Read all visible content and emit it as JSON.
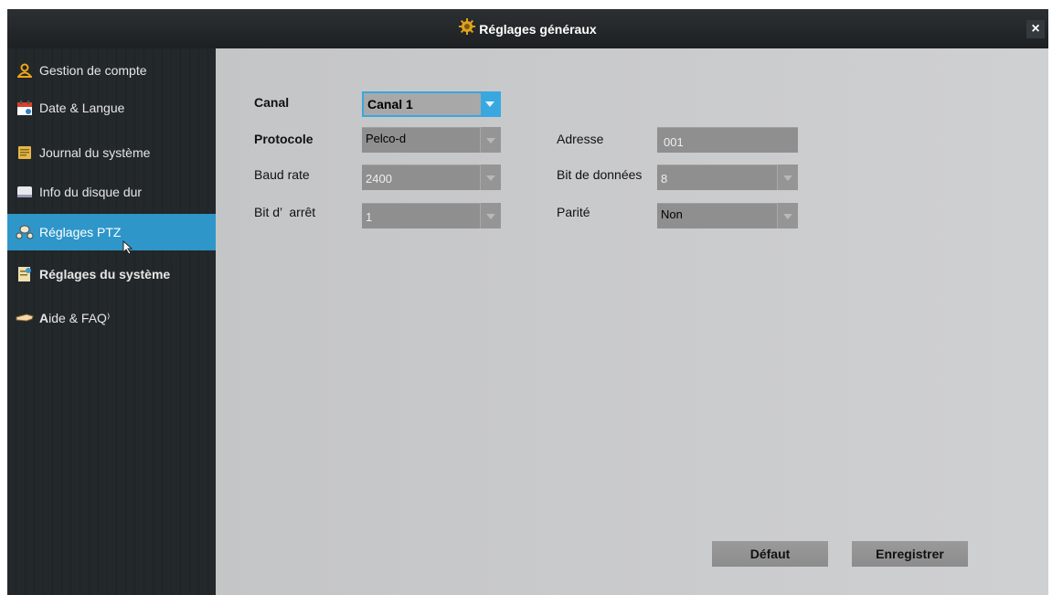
{
  "window": {
    "title": "Réglages généraux",
    "close_label": "×"
  },
  "sidebar": {
    "items": [
      {
        "label": "Gestion de compte",
        "icon": "user-icon"
      },
      {
        "label": "Date & Langue",
        "icon": "calendar-icon"
      },
      {
        "label": "Journal du système",
        "icon": "log-book-icon"
      },
      {
        "label": "Info du disque dur",
        "icon": "hard-disk-icon"
      },
      {
        "label": "Réglages PTZ",
        "icon": "ptz-camera-icon",
        "active": true
      },
      {
        "label": "Réglages du système",
        "icon": "system-settings-icon"
      },
      {
        "label_bold": "A",
        "label": " ide & FAQ⁾",
        "icon": "help-hand-icon"
      }
    ]
  },
  "form": {
    "canal": {
      "label": "Canal",
      "value": "Canal 1"
    },
    "protocole": {
      "label": "Protocole",
      "value": "Pelco-d"
    },
    "adresse": {
      "label": "Adresse",
      "value": "001"
    },
    "baud_rate": {
      "label": "Baud rate",
      "value": "2400"
    },
    "bit_donnees": {
      "label": "Bit de données",
      "value": "8"
    },
    "bit_arret": {
      "label": "Bit d’  arrêt",
      "value": "1"
    },
    "parite": {
      "label": "Parité",
      "value": "Non"
    }
  },
  "buttons": {
    "default_label": "Défaut",
    "save_label": "Enregistrer"
  },
  "colors": {
    "accent": "#2e96c9",
    "sidebar_bg": "#23282a",
    "content_bg": "#c9cacc"
  }
}
